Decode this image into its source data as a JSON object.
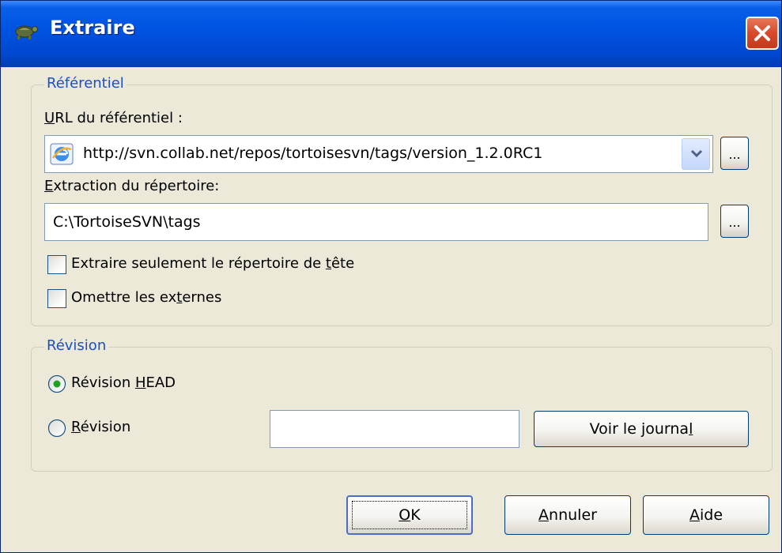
{
  "window": {
    "title": "Extraire",
    "close_symbol": "×",
    "icon": "tortoise-icon"
  },
  "repository_group": {
    "legend": "Référentiel",
    "url_label_key": "U",
    "url_label_rest": "RL du référentiel :",
    "url_value": "http://svn.collab.net/repos/tortoisesvn/tags/version_1.2.0RC1",
    "url_browse_label": "...",
    "checkout_label_key": "E",
    "checkout_label_rest": "xtraction du répertoire:",
    "checkout_value": "C:\\TortoiseSVN\\tags",
    "checkout_browse_label": "...",
    "head_only_label_before": "Extraire seulement le répertoire de ",
    "head_only_label_key": "t",
    "head_only_label_after": "ête",
    "head_only_checked": false,
    "omit_externals_label_before": "Omettre les ex",
    "omit_externals_label_key": "t",
    "omit_externals_label_after": "ernes",
    "omit_externals_checked": false
  },
  "revision_group": {
    "legend": "Révision",
    "head_label_before": "Révision ",
    "head_label_key": "H",
    "head_label_after": "EAD",
    "head_selected": true,
    "revision_label_key": "R",
    "revision_label_rest": "évision",
    "revision_selected": false,
    "revision_value": "",
    "show_log_label_before": "Voir le journa",
    "show_log_label_key": "l",
    "show_log_label_after": ""
  },
  "buttons": {
    "ok_label_key": "O",
    "ok_label_rest": "K",
    "cancel_label_key": "A",
    "cancel_label_rest": "nnuler",
    "help_label_key": "A",
    "help_label_rest": "ide"
  },
  "colors": {
    "titlebar": "#0054e3",
    "dialog_bg": "#ece9d8",
    "group_legend": "#1c4fc0",
    "close_button": "#d9482a"
  }
}
